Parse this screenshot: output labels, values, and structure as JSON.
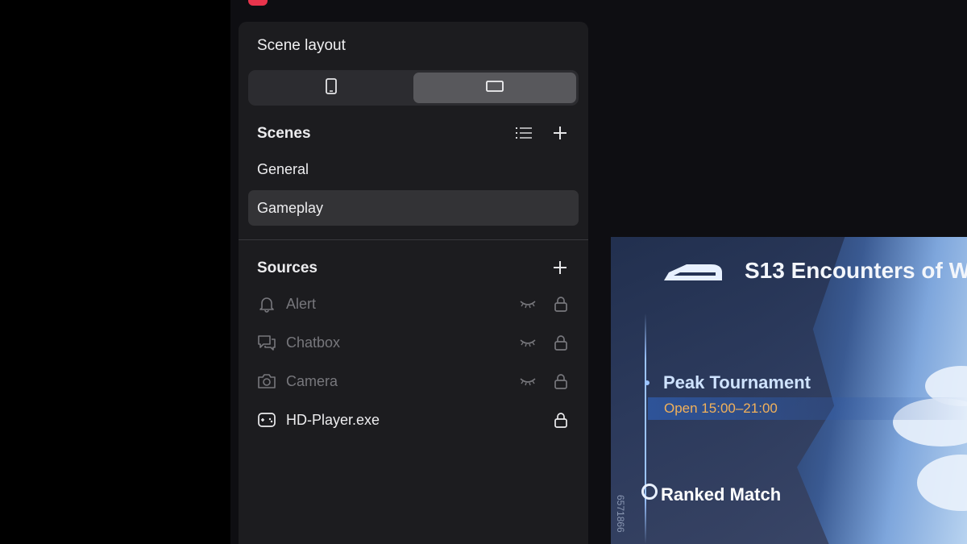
{
  "panel": {
    "layout_title": "Scene layout",
    "layout_options": [
      {
        "icon": "phone-portrait-icon",
        "selected": false
      },
      {
        "icon": "landscape-screen-icon",
        "selected": true
      }
    ],
    "scenes_title": "Scenes",
    "scenes": [
      {
        "label": "General",
        "selected": false
      },
      {
        "label": "Gameplay",
        "selected": true
      }
    ],
    "sources_title": "Sources",
    "sources": [
      {
        "label": "Alert",
        "icon": "bell-icon",
        "hidden": true,
        "locked": true
      },
      {
        "label": "Chatbox",
        "icon": "chat-bubbles-icon",
        "hidden": true,
        "locked": true
      },
      {
        "label": "Camera",
        "icon": "camera-icon",
        "hidden": true,
        "locked": true
      },
      {
        "label": "HD-Player.exe",
        "icon": "gamepad-icon",
        "hidden": false,
        "locked": true
      }
    ]
  },
  "preview": {
    "banner_title": "S13 Encounters of W",
    "event_title": "Peak Tournament",
    "event_time": "Open 15:00–21:00",
    "match_label": "Ranked Match",
    "uid_fragment": "6571866"
  },
  "colors": {
    "accent_time": "#f2b15a",
    "brand": "#e8344c"
  }
}
